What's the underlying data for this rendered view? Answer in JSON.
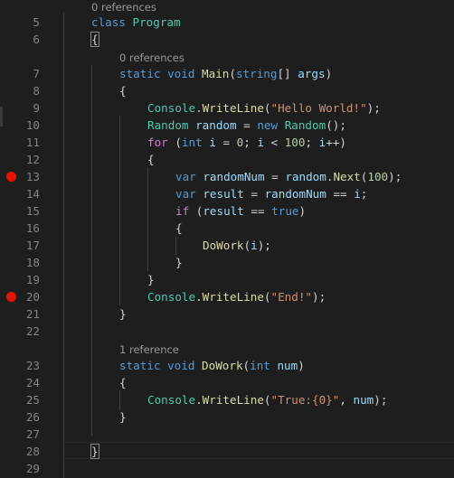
{
  "editor": {
    "language": "csharp",
    "colors": {
      "background": "#1e1e1e",
      "line_number": "#858585",
      "keyword": "#569cd6",
      "control": "#c586c0",
      "type": "#4ec9b0",
      "function": "#dcdcaa",
      "variable": "#9cdcfe",
      "string": "#ce9178",
      "number": "#b5cea8",
      "breakpoint": "#e51400"
    },
    "codelens": {
      "class_program": "0 references",
      "main": "0 references",
      "dowork": "1 reference"
    },
    "line_numbers": {
      "l5": "5",
      "l6": "6",
      "l7": "7",
      "l8": "8",
      "l9": "9",
      "l10": "10",
      "l11": "11",
      "l12": "12",
      "l13": "13",
      "l14": "14",
      "l15": "15",
      "l16": "16",
      "l17": "17",
      "l18": "18",
      "l19": "19",
      "l20": "20",
      "l21": "21",
      "l22": "22",
      "l23": "23",
      "l24": "24",
      "l25": "25",
      "l26": "26",
      "l27": "27",
      "l28": "28",
      "l29": "29"
    },
    "breakpoints": [
      "13",
      "20"
    ],
    "tokens": {
      "class": "class",
      "program": "Program",
      "static": "static",
      "void": "void",
      "main": "Main",
      "string": "string",
      "args": "args",
      "console": "Console",
      "writeline": "WriteLine",
      "hello": "\"Hello World!\"",
      "random_type": "Random",
      "random_var": "random",
      "new": "new",
      "for": "for",
      "int": "int",
      "i": "i",
      "zero": "0",
      "hundred": "100",
      "var": "var",
      "randomNum": "randomNum",
      "next": "Next",
      "result": "result",
      "if": "if",
      "true": "true",
      "dowork": "DoWork",
      "end": "\"End!\"",
      "num": "num",
      "truefmt": "\"True:{0}\""
    }
  }
}
